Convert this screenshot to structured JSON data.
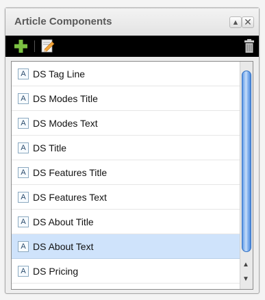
{
  "panel": {
    "title": "Article Components"
  },
  "titlebar": {
    "collapse_glyph": "▲",
    "close_glyph": "✕"
  },
  "toolbar": {
    "icons": [
      "plus-icon",
      "edit-icon",
      "trash-icon"
    ],
    "add_color": "#7bc142"
  },
  "list": {
    "item_icon_glyph": "A",
    "selected_index": 7,
    "items": [
      "DS Tag Line",
      "DS Modes Title",
      "DS Modes Text",
      "DS Title",
      "DS Features Title",
      "DS Features Text",
      "DS About Title",
      "DS About Text",
      "DS Pricing"
    ]
  },
  "scrollbar": {
    "up_glyph": "▲",
    "down_glyph": "▼"
  }
}
